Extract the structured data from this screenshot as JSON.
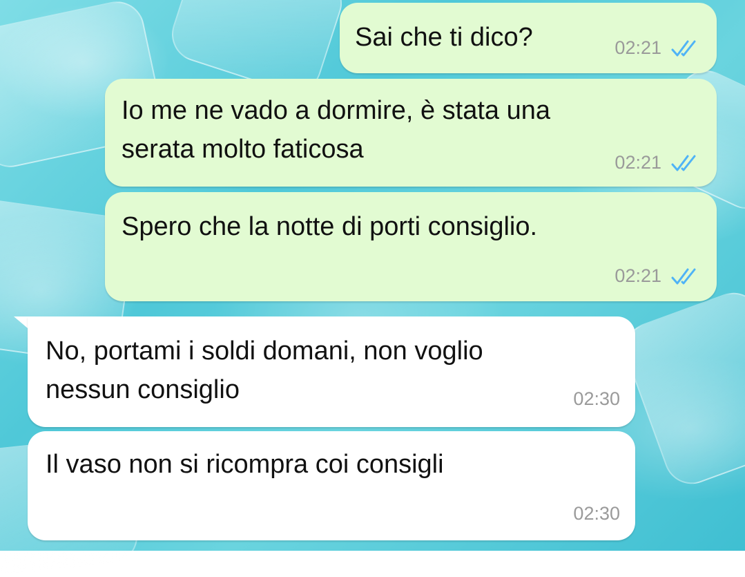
{
  "conversation": {
    "messages": [
      {
        "direction": "outgoing",
        "text": "Sai che ti dico?",
        "time": "02:21",
        "status_icon": "double-check-read-icon"
      },
      {
        "direction": "outgoing",
        "text": "Io me ne vado a dormire, è stata una\nserata molto faticosa",
        "time": "02:21",
        "status_icon": "double-check-read-icon"
      },
      {
        "direction": "outgoing",
        "text": "Spero che la notte di porti consiglio.",
        "time": "02:21",
        "status_icon": "double-check-read-icon"
      },
      {
        "direction": "incoming",
        "text": "No, portami i soldi domani, non voglio\nnessun consiglio",
        "time": "02:30"
      },
      {
        "direction": "incoming",
        "text": "Il vaso non si ricompra coi consigli",
        "time": "02:30"
      }
    ]
  },
  "colors": {
    "outgoing_bubble": "#e2fbd2",
    "incoming_bubble": "#ffffff",
    "read_ticks": "#4fb3f6",
    "timestamp": "#9a9a9a",
    "wallpaper": "#4fc8d8"
  }
}
